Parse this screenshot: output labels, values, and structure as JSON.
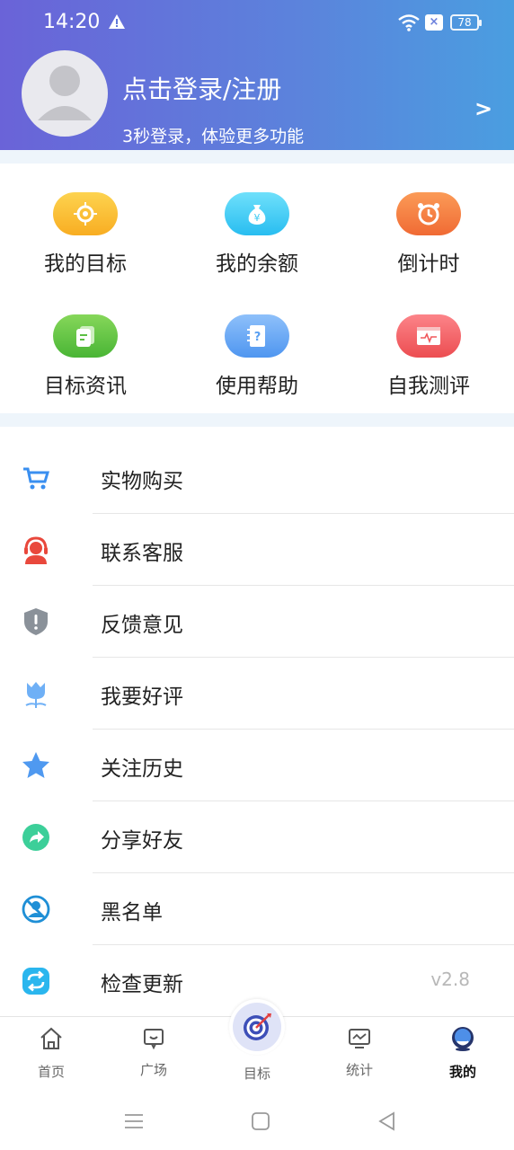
{
  "status": {
    "time": "14:20",
    "battery": "78",
    "sim_icon": "sim-x-icon",
    "wifi_icon": "wifi-icon",
    "alert_icon": "warning-icon"
  },
  "profile": {
    "title": "点击登录/注册",
    "subtitle": "3秒登录，体验更多功能",
    "arrow": ">"
  },
  "grid": [
    {
      "label": "我的目标",
      "icon": "target-icon",
      "color": "#f9b62b"
    },
    {
      "label": "我的余额",
      "icon": "money-bag-icon",
      "color": "#3cc9f3"
    },
    {
      "label": "倒计时",
      "icon": "alarm-clock-icon",
      "color": "#f37a3e"
    },
    {
      "label": "目标资讯",
      "icon": "news-icon",
      "color": "#5cbf43"
    },
    {
      "label": "使用帮助",
      "icon": "help-book-icon",
      "color": "#5aa0f2"
    },
    {
      "label": "自我测评",
      "icon": "monitor-pulse-icon",
      "color": "#f0585c"
    }
  ],
  "menu": [
    {
      "label": "实物购买",
      "icon": "cart-icon"
    },
    {
      "label": "联系客服",
      "icon": "customer-service-icon"
    },
    {
      "label": "反馈意见",
      "icon": "shield-alert-icon"
    },
    {
      "label": "我要好评",
      "icon": "flower-icon"
    },
    {
      "label": "关注历史",
      "icon": "star-icon"
    },
    {
      "label": "分享好友",
      "icon": "share-icon"
    },
    {
      "label": "黑名单",
      "icon": "blacklist-icon"
    },
    {
      "label": "检查更新",
      "icon": "refresh-icon",
      "value": "v2.8"
    }
  ],
  "tabs": [
    {
      "label": "首页",
      "icon": "home-icon"
    },
    {
      "label": "广场",
      "icon": "chat-square-icon"
    },
    {
      "label": "目标",
      "icon": "dart-target-icon"
    },
    {
      "label": "统计",
      "icon": "tv-chart-icon"
    },
    {
      "label": "我的",
      "icon": "user-avatar-icon",
      "active": true
    }
  ],
  "colors": {
    "header_start": "#6a63d8",
    "header_end": "#4a9ee0",
    "separator": "#eef5fb",
    "divider": "#e6e6e6",
    "version": "#b8b8b8"
  }
}
